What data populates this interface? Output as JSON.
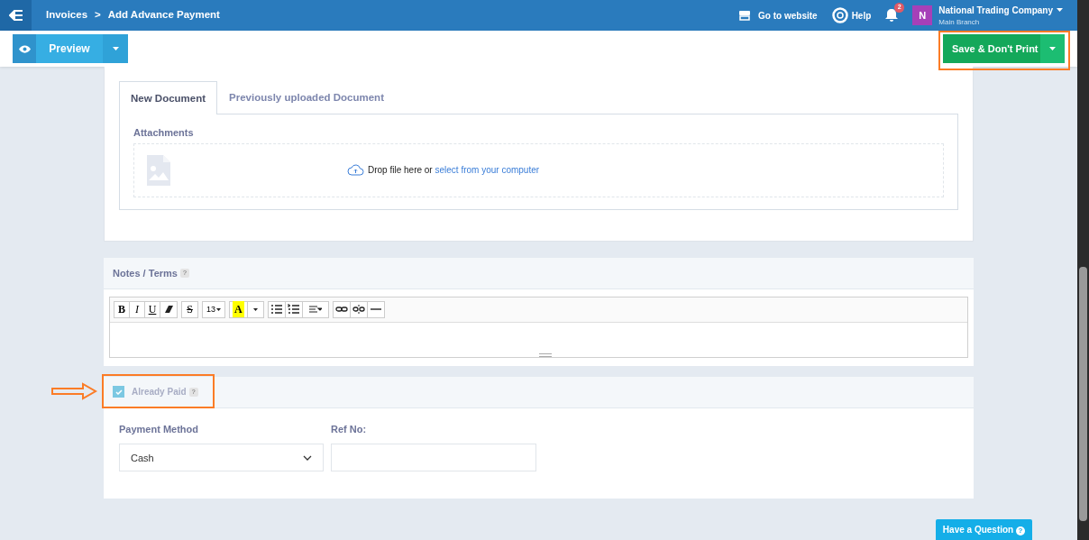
{
  "topbar": {
    "breadcrumb": [
      "Invoices",
      "Add Advance Payment"
    ],
    "breadcrumb_separator": ">",
    "website_link": "Go to website",
    "help_link": "Help",
    "notification_count": "2",
    "company": {
      "initial": "N",
      "name": "National Trading Company",
      "branch": "Main Branch"
    }
  },
  "toolbar": {
    "preview_button": "Preview",
    "save_button": "Save & Don't Print"
  },
  "attachments": {
    "tabs": [
      {
        "label": "New Document",
        "selected": true
      },
      {
        "label": "Previously uploaded Document",
        "selected": false
      }
    ],
    "label": "Attachments",
    "drop_text": "Drop file here or ",
    "drop_link": "select from your computer"
  },
  "notes": {
    "title": "Notes / Terms",
    "help": "?",
    "editor_toolbar": [
      [
        {
          "kind": "bold",
          "label": "B"
        },
        {
          "kind": "italic",
          "label": "I"
        },
        {
          "kind": "underline",
          "label": "U"
        },
        {
          "kind": "eraser"
        }
      ],
      [
        {
          "kind": "strike",
          "label": "S"
        }
      ],
      [
        {
          "kind": "size",
          "label": "13"
        }
      ],
      [
        {
          "kind": "color",
          "label": "A"
        },
        {
          "kind": "caret"
        }
      ],
      [
        {
          "kind": "ul"
        },
        {
          "kind": "ol"
        },
        {
          "kind": "align"
        }
      ],
      [
        {
          "kind": "link"
        },
        {
          "kind": "unlink"
        },
        {
          "kind": "hr"
        }
      ]
    ]
  },
  "payment": {
    "already_paid": {
      "label": "Already Paid",
      "help": "?",
      "checked": true
    },
    "payment_method": {
      "label": "Payment Method",
      "value": "Cash"
    },
    "ref_no": {
      "label": "Ref No:"
    }
  },
  "help_button": {
    "label": "Have a Question",
    "icon": "?"
  }
}
